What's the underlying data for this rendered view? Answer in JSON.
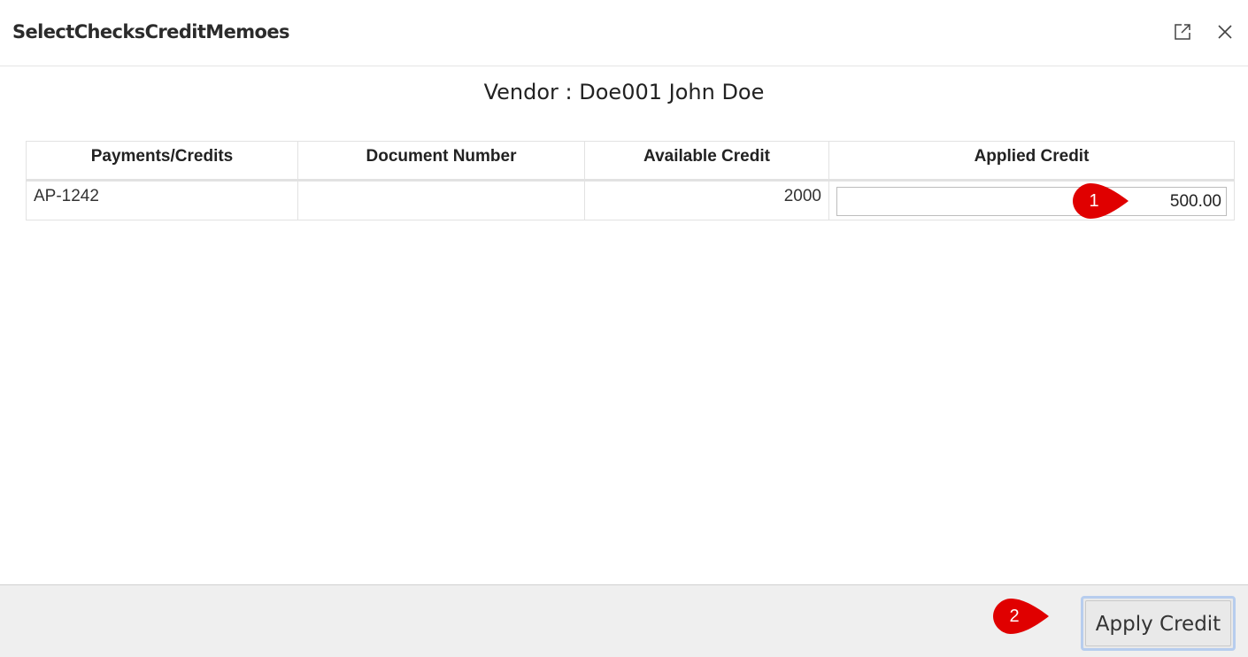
{
  "window": {
    "title": "SelectChecksCreditMemoes",
    "maximize_icon": "maximize-icon",
    "close_icon": "close-icon"
  },
  "vendor": {
    "label": "Vendor : Doe001 John Doe"
  },
  "table": {
    "columns": [
      "Payments/Credits",
      "Document Number",
      "Available Credit",
      "Applied Credit"
    ],
    "rows": [
      {
        "payment": "AP-1242",
        "document_number": "",
        "available_credit": "2000",
        "applied_credit": "500.00"
      }
    ]
  },
  "footer": {
    "apply_label": "Apply Credit"
  },
  "annotations": {
    "marker_1": "1",
    "marker_2": "2",
    "color": "#e00000"
  }
}
